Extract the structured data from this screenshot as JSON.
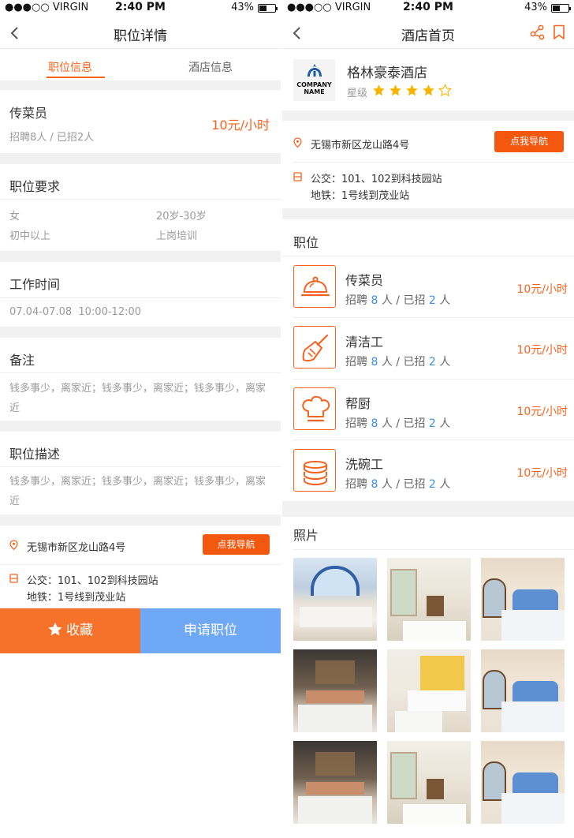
{
  "status_bar": {
    "carrier": "●●●○○ VIRGIN",
    "time": "2:40 PM",
    "battery": "43%"
  },
  "job_detail": {
    "nav_title": "职位详情",
    "tabs": [
      "职位信息",
      "酒店信息"
    ],
    "job": {
      "title": "传菜员",
      "stats": "招聘8人 / 已招2人",
      "wage": "10元/小时"
    },
    "requirements": {
      "heading": "职位要求",
      "gender": "女",
      "age": "20岁-30岁",
      "education": "初中以上",
      "training": "上岗培训"
    },
    "work_time": {
      "heading": "工作时间",
      "value": "07.04-07.08  10:00-12:00"
    },
    "notes": {
      "heading": "备注",
      "value": "钱多事少，离家近；钱多事少，离家近；钱多事少，离家近"
    },
    "description": {
      "heading": "职位描述",
      "value": "钱多事少，离家近；钱多事少，离家近；钱多事少，离家近"
    },
    "address": "无锡市新区龙山路4号",
    "nav_button": "点我导航",
    "transit_bus": "公交：101、102到科技园站",
    "transit_metro": "地铁：1号线到茂业站",
    "favorite_button": "收藏",
    "apply_button": "申请职位"
  },
  "hotel_home": {
    "nav_title": "酒店首页",
    "logo_text": [
      "COMPANY",
      "NAME"
    ],
    "hotel_name": "格林豪泰酒店",
    "rating_label": "星级",
    "rating": 4,
    "rating_max": 5,
    "address": "无锡市新区龙山路4号",
    "nav_button": "点我导航",
    "transit_bus": "公交：101、102到科技园站",
    "transit_metro": "地铁：1号线到茂业站",
    "jobs_heading": "职位",
    "jobs": [
      {
        "title": "传菜员",
        "recruit_prefix": "招聘",
        "recruit": "8",
        "recruit_unit": "人 / 已招",
        "hired": "2",
        "hired_unit": "人",
        "wage": "10元/小时",
        "icon": "cloche-icon"
      },
      {
        "title": "清洁工",
        "recruit_prefix": "招聘",
        "recruit": "8",
        "recruit_unit": "人 / 已招",
        "hired": "2",
        "hired_unit": "人",
        "wage": "10元/小时",
        "icon": "broom-icon"
      },
      {
        "title": "帮厨",
        "recruit_prefix": "招聘",
        "recruit": "8",
        "recruit_unit": "人 / 已招",
        "hired": "2",
        "hired_unit": "人",
        "wage": "10元/小时",
        "icon": "chef-hat-icon"
      },
      {
        "title": "洗碗工",
        "recruit_prefix": "招聘",
        "recruit": "8",
        "recruit_unit": "人 / 已招",
        "hired": "2",
        "hired_unit": "人",
        "wage": "10元/小时",
        "icon": "dishes-icon"
      }
    ],
    "photos_heading": "照片"
  },
  "colors": {
    "accent": "#f4631f",
    "button": "#f4580f",
    "apply": "#6fa8f5",
    "count": "#3a8ee6",
    "star": "#f7b500"
  }
}
